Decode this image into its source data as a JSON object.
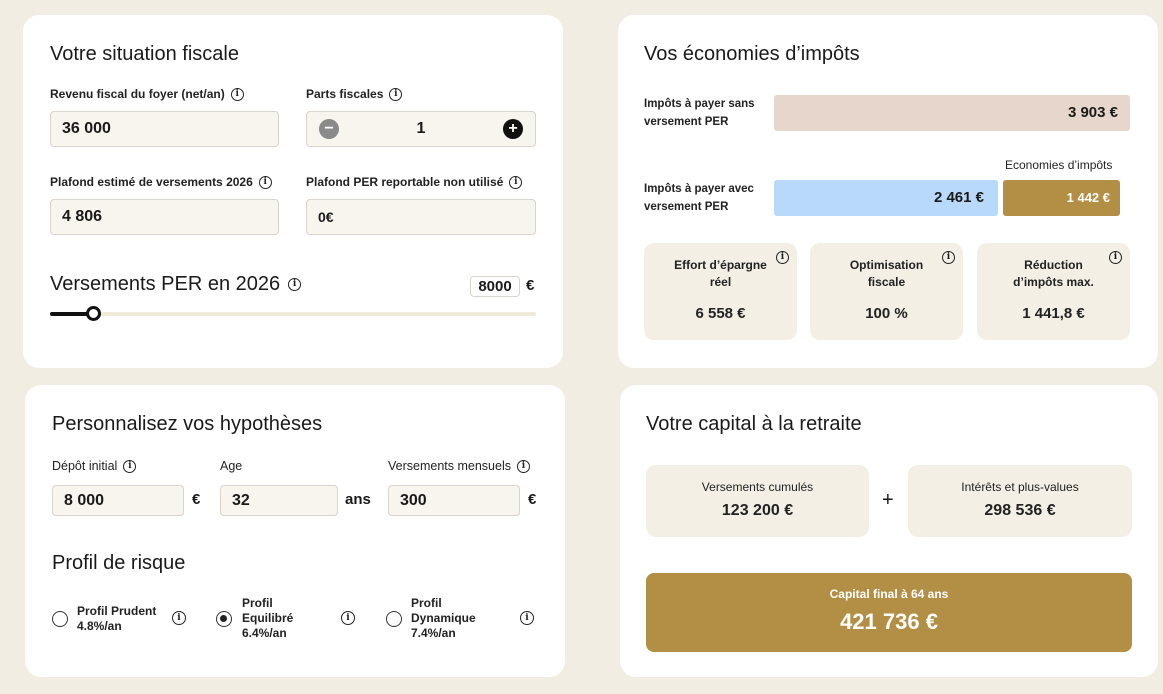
{
  "fiscal": {
    "title": "Votre situation fiscale",
    "revenu_label": "Revenu fiscal du foyer (net/an)",
    "revenu_value": "36 000",
    "parts_label": "Parts fiscales",
    "parts_value": "1",
    "plafond_label": "Plafond estimé de versements 2026",
    "plafond_value": "4 806",
    "reportable_label": "Plafond PER reportable non utilisé",
    "reportable_value": "0€",
    "versements_label": "Versements PER en 2026",
    "versements_value": "8000",
    "versements_unit": "€",
    "slider_fraction": 0.09
  },
  "economies": {
    "title": "Vos économies d’impôts",
    "sans_label_1": "Impôts à payer sans",
    "sans_label_2": "versement PER",
    "sans_value": "3 903 €",
    "economies_header": "Economies d’impôts",
    "avec_label_1": "Impôts à payer avec",
    "avec_label_2": "versement PER",
    "avec_value": "2 461 €",
    "economie_value": "1 442 €",
    "tiles": [
      {
        "l1": "Effort d’épargne",
        "l2": "réel",
        "value": "6 558 €"
      },
      {
        "l1": "Optimisation",
        "l2": "fiscale",
        "value": "100 %"
      },
      {
        "l1": "Réduction",
        "l2": "d’impôts max.",
        "value": "1 441,8 €"
      }
    ]
  },
  "hypotheses": {
    "title": "Personnalisez vos hypothèses",
    "depot_label": "Dépôt initial",
    "depot_value": "8 000",
    "depot_unit": "€",
    "age_label": "Age",
    "age_value": "32",
    "age_unit": "ans",
    "mensuels_label": "Versements mensuels",
    "mensuels_value": "300",
    "mensuels_unit": "€",
    "profil_title": "Profil de risque",
    "profils": [
      {
        "l1": "Profil Prudent",
        "l2": "4.8%/an",
        "l3": ""
      },
      {
        "l1": "Profil",
        "l2": "Equilibré",
        "l3": "6.4%/an"
      },
      {
        "l1": "Profil",
        "l2": "Dynamique",
        "l3": "7.4%/an"
      }
    ]
  },
  "capital": {
    "title": "Votre capital à la retraite",
    "cumules_label": "Versements cumulés",
    "cumules_value": "123 200 €",
    "plus": "+",
    "interets_label": "Intérêts et plus-values",
    "interets_value": "298 536 €",
    "final_label": "Capital final à 64 ans",
    "final_value": "421 736 €"
  },
  "colors": {
    "accent_gold": "#b38f45",
    "sans_bar": "#e6d6cb",
    "avec_bar": "#b9d9fb",
    "background": "#f2ede3"
  },
  "icons": [
    "info-icon",
    "minus-icon",
    "plus-icon",
    "radio-button"
  ]
}
